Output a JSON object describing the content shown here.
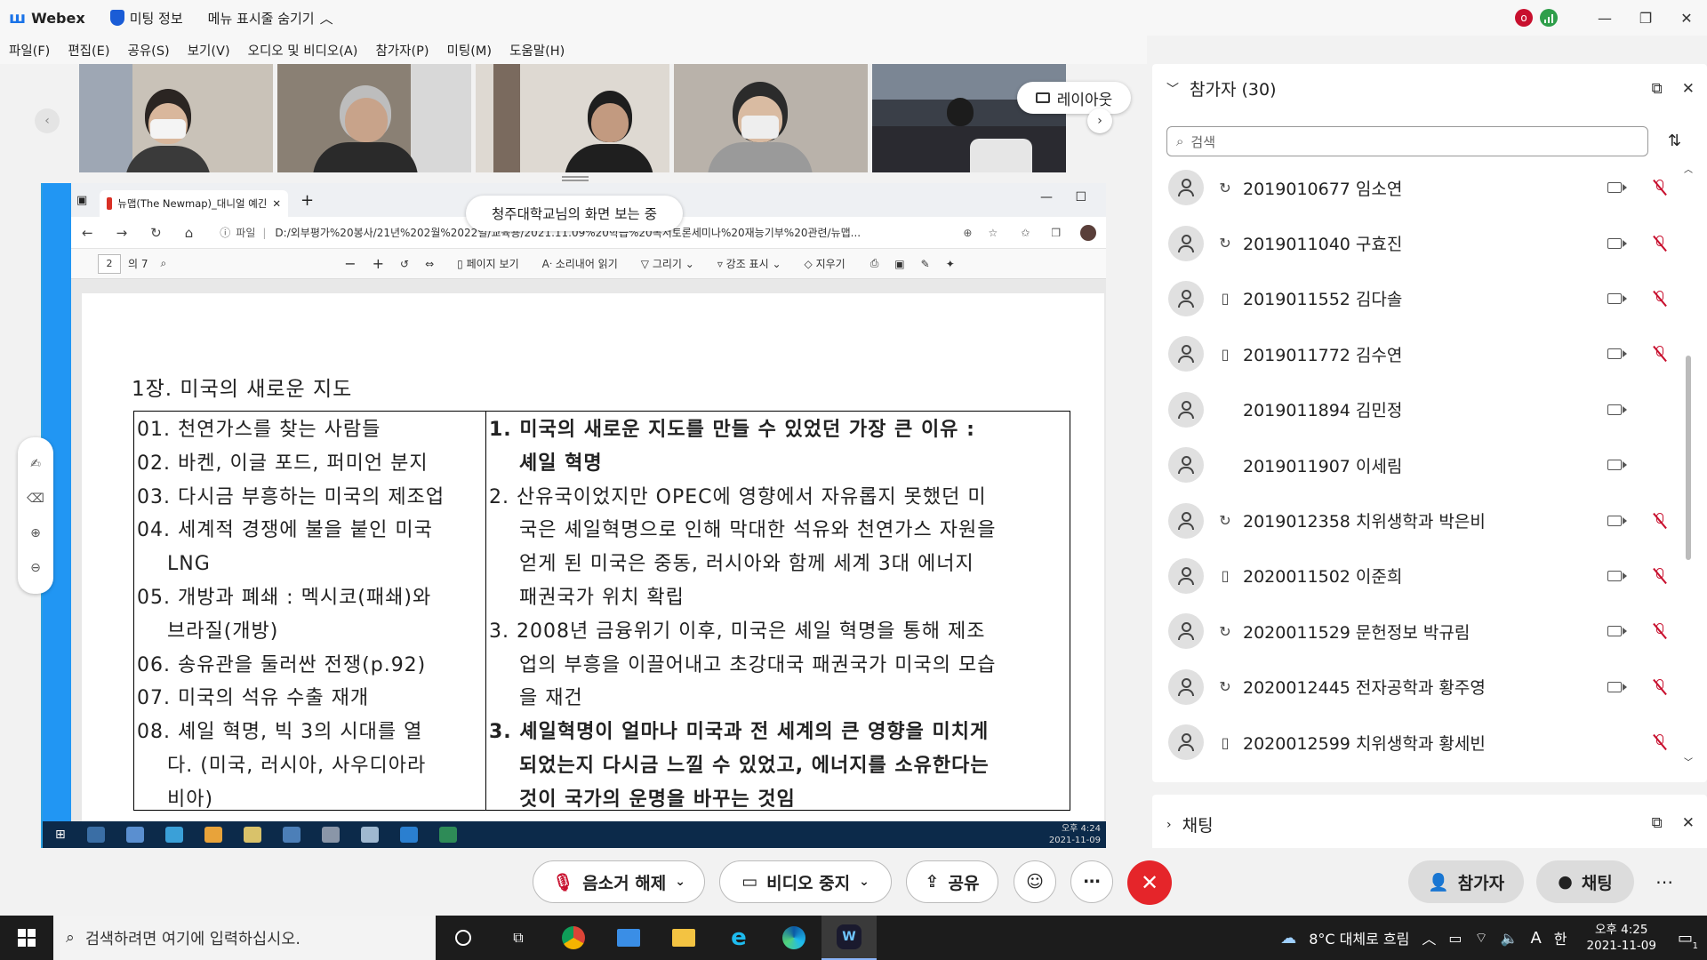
{
  "titlebar": {
    "app_name": "Webex",
    "meeting_info": "미팅 정보",
    "hide_menu": "메뉴 표시줄 숨기기",
    "rec_letter": "o"
  },
  "menu": [
    "파일(F)",
    "편집(E)",
    "공유(S)",
    "보기(V)",
    "오디오 및 비디오(A)",
    "참가자(P)",
    "미팅(M)",
    "도움말(H)"
  ],
  "video": {
    "layout_label": "레이아웃"
  },
  "share": {
    "banner": "청주대학교님의 화면 보는 중",
    "tab_title": "뉴맵(The Newmap)_대니얼 예긴",
    "file_label": "파일",
    "url": "D:/외부평가%20봉사/21년%202월%2022일/교육용/2021.11.09%20학습%20독서토론세미나%20재능기부%20관련/뉴맵...",
    "page_num": "2",
    "page_total": "의 7",
    "toolbar": {
      "page_view": "페이지 보기",
      "read_aloud": "소리내어 읽기",
      "draw": "그리기",
      "highlight": "강조 표시",
      "erase": "지우기"
    },
    "doc": {
      "chapter": "1장. 미국의 새로운 지도",
      "left_items": [
        {
          "num": "01.",
          "text": "천연가스를 찾는 사람들"
        },
        {
          "num": "02.",
          "text": "바켄, 이글 포드, 퍼미언 분지"
        },
        {
          "num": "03.",
          "text": "다시금 부흥하는 미국의 제조업"
        },
        {
          "num": "04.",
          "text": "세계적 경쟁에 불을 붙인 미국",
          "cont": "LNG"
        },
        {
          "num": "05.",
          "text": "개방과 폐쇄 : 멕시코(패쇄)와",
          "cont": "브라질(개방)"
        },
        {
          "num": "06.",
          "text": "송유관을 둘러싼 전쟁(p.92)"
        },
        {
          "num": "07.",
          "text": "미국의 석유 수출 재개"
        },
        {
          "num": "08.",
          "text": "셰일 혁명, 빅 3의 시대를 열",
          "cont": "다. (미국, 러시아, 사우디아라",
          "cont2": "비아)"
        }
      ],
      "right_items": [
        {
          "num": "1.",
          "lines": [
            "미국의 새로운 지도를 만들 수 있었던 가장 큰 이유 :",
            "셰일 혁명"
          ],
          "bold": true
        },
        {
          "num": "2.",
          "lines": [
            "산유국이었지만 OPEC에 영향에서 자유롭지 못했던 미",
            "국은 셰일혁명으로 인해 막대한 석유와 천연가스 자원을",
            "얻게 된 미국은 중동, 러시아와 함께 세계 3대 에너지",
            "패권국가 위치 확립"
          ],
          "bold": false
        },
        {
          "num": "3.",
          "lines": [
            "2008년 금융위기 이후, 미국은 셰일 혁명을 통해 제조",
            "업의 부흥을 이끌어내고 초강대국 패권국가 미국의 모습",
            "을 재건"
          ],
          "bold": false
        },
        {
          "num": "3.",
          "lines": [
            "셰일혁명이 얼마나 미국과 전 세계의 큰 영향을 미치게",
            "되었는지 다시금 느낄 수 있었고, 에너지를 소유한다는",
            "것이 국가의 운명을 바꾸는 것임"
          ],
          "bold": true
        }
      ]
    },
    "remote_clock": {
      "time": "오후 4:24",
      "date": "2021-11-09"
    }
  },
  "participants": {
    "title": "참가자 (30)",
    "search_placeholder": "검색",
    "list": [
      {
        "name": "2019010677 임소연",
        "device": "headset",
        "camera": true,
        "muted": true
      },
      {
        "name": "2019011040 구효진",
        "device": "headset",
        "camera": true,
        "muted": true
      },
      {
        "name": "2019011552 김다솔",
        "device": "mobile",
        "camera": true,
        "muted": true
      },
      {
        "name": "2019011772 김수연",
        "device": "mobile",
        "camera": true,
        "muted": true
      },
      {
        "name": "2019011894 김민정",
        "device": "none",
        "camera": true,
        "muted": false
      },
      {
        "name": "2019011907 이세림",
        "device": "none",
        "camera": true,
        "muted": false
      },
      {
        "name": "2019012358 치위생학과 박은비",
        "device": "headset",
        "camera": true,
        "muted": true
      },
      {
        "name": "2020011502 이준희",
        "device": "mobile",
        "camera": true,
        "muted": true
      },
      {
        "name": "2020011529 문헌정보 박규림",
        "device": "headset",
        "camera": true,
        "muted": true
      },
      {
        "name": "2020012445 전자공학과 황주영",
        "device": "headset",
        "camera": true,
        "muted": true
      },
      {
        "name": "2020012599 치위생학과 황세빈",
        "device": "mobile",
        "camera": false,
        "muted": true
      }
    ]
  },
  "chat": {
    "title": "채팅"
  },
  "controls": {
    "unmute": "음소거 해제",
    "stop_video": "비디오 중지",
    "share": "공유",
    "participants": "참가자",
    "chat": "채팅"
  },
  "taskbar": {
    "search_placeholder": "검색하려면 여기에 입력하십시오.",
    "weather": "8°C 대체로 흐림",
    "ime": "A",
    "lang": "한",
    "time": "오후 4:25",
    "date": "2021-11-09",
    "notif_count": "1"
  },
  "colors": {
    "accent": "#2196f3",
    "end_call": "#e5252a",
    "muted": "#c8102e",
    "taskbar": "#1c1c1c"
  }
}
